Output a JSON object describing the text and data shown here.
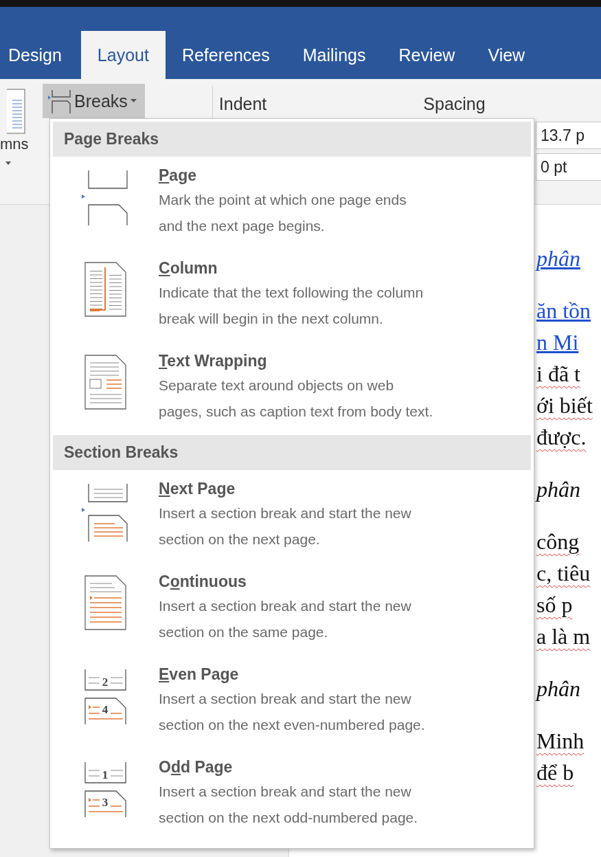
{
  "tabs": [
    {
      "label": "Design",
      "selected": false
    },
    {
      "label": "Layout",
      "selected": true
    },
    {
      "label": "References",
      "selected": false
    },
    {
      "label": "Mailings",
      "selected": false
    },
    {
      "label": "Review",
      "selected": false
    },
    {
      "label": "View",
      "selected": false
    }
  ],
  "ribbon": {
    "columns_label": "mns",
    "breaks_button": {
      "label": "Breaks",
      "expanded": true
    },
    "indent_label": "Indent",
    "spacing_label": "Spacing",
    "spacing_before": "13.7 p",
    "spacing_after": "0 pt"
  },
  "breaks_menu": [
    {
      "heading": "Page Breaks",
      "items": [
        {
          "kind": "page",
          "title": {
            "key": "P",
            "after": "age"
          },
          "description": [
            "Mark the point at which one page ends",
            "and the next page begins."
          ]
        },
        {
          "kind": "column",
          "title": {
            "key": "C",
            "after": "olumn"
          },
          "description": [
            "Indicate that the text following the column",
            "break will begin in the next column."
          ]
        },
        {
          "kind": "text_wrapping",
          "title": {
            "key": "T",
            "after": "ext Wrapping"
          },
          "description": [
            "Separate text around objects on web",
            "pages, such as caption text from body text."
          ]
        }
      ]
    },
    {
      "heading": "Section Breaks",
      "items": [
        {
          "kind": "next_page",
          "title": {
            "key": "N",
            "after": "ext Page"
          },
          "description": [
            "Insert a section break and start the new",
            "section on the next page."
          ]
        },
        {
          "kind": "continuous",
          "title": {
            "before": "C",
            "key": "o",
            "after": "ntinuous"
          },
          "description": [
            "Insert a section break and start the new",
            "section on the same page."
          ]
        },
        {
          "kind": "even_page",
          "title": {
            "key": "E",
            "after": "ven Page"
          },
          "icon_digits": [
            "2",
            "4"
          ],
          "description": [
            "Insert a section break and start the new",
            "section on the next even-numbered page."
          ]
        },
        {
          "kind": "odd_page",
          "title": {
            "before": "O",
            "key": "d",
            "after": "d Page"
          },
          "icon_digits": [
            "1",
            "3"
          ],
          "description": [
            "Insert a section break and start the new",
            "section on the next odd-numbered page."
          ]
        }
      ]
    }
  ],
  "document": [
    {
      "lines": [
        {
          "kind": "link_italic",
          "text": "phân"
        }
      ]
    },
    {
      "lines": [
        {
          "kind": "link",
          "text": "ăn tồn"
        },
        {
          "kind": "link",
          "text": "n Mi"
        },
        {
          "kind": "plain",
          "text": "i đã t"
        },
        {
          "kind": "plain",
          "text": "ới biết"
        },
        {
          "kind": "plain",
          "text": "được."
        }
      ]
    },
    {
      "lines": [
        {
          "kind": "italic",
          "text": "phân"
        }
      ]
    },
    {
      "lines": [
        {
          "kind": "plain",
          "text": "công"
        },
        {
          "kind": "plain",
          "text": "c, tiêu"
        },
        {
          "kind": "plain",
          "text": "số p"
        },
        {
          "kind": "plain",
          "text": "a là m"
        }
      ]
    },
    {
      "lines": [
        {
          "kind": "italic",
          "text": "phân"
        }
      ]
    },
    {
      "lines": [
        {
          "kind": "plain",
          "text": "Minh"
        },
        {
          "kind": "plain",
          "text": "để b"
        }
      ]
    }
  ]
}
